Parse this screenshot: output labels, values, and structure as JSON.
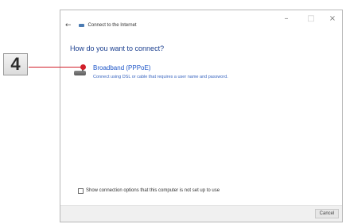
{
  "callout": {
    "step_number": "4",
    "color": "#d11f2a"
  },
  "window": {
    "title": "Connect to the Internet",
    "controls": {
      "minimize": "–",
      "maximize": "□",
      "close": "×"
    },
    "back_icon": "back-arrow-icon",
    "title_icon": "network-globe-icon"
  },
  "main": {
    "heading": "How do you want to connect?",
    "options": [
      {
        "title": "Broadband (PPPoE)",
        "description": "Connect using DSL or cable that requires a user name and password.",
        "icon": "broadband-modem-icon"
      }
    ],
    "checkbox": {
      "label": "Show connection options that this computer is not set up to use",
      "checked": false
    }
  },
  "footer": {
    "cancel_label": "Cancel"
  },
  "colors": {
    "heading": "#1b3f8f",
    "link": "#1e56c8",
    "footer_bg": "#f0f0f0"
  }
}
